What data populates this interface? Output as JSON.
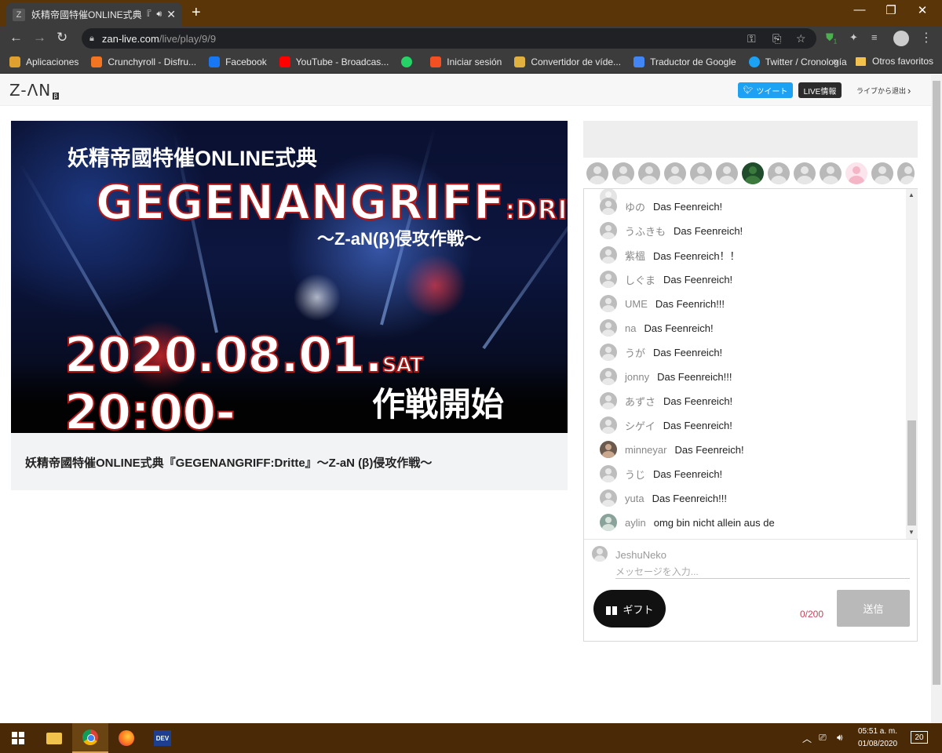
{
  "browser": {
    "tab_title": "妖精帝國特催ONLINE式典『G",
    "url_host": "zan-live.com",
    "url_path": "/live/play/9/9",
    "bookmarks": [
      {
        "label": "Aplicaciones",
        "color": "#e0a030"
      },
      {
        "label": "Crunchyroll - Disfru...",
        "color": "#f47521"
      },
      {
        "label": "Facebook",
        "color": "#1877f2"
      },
      {
        "label": "YouTube - Broadcas...",
        "color": "#ff0000"
      },
      {
        "label": "",
        "color": "#25d366"
      },
      {
        "label": "Iniciar sesión",
        "color": "#f25022"
      },
      {
        "label": "Convertidor de víde...",
        "color": "#e0b040"
      },
      {
        "label": "Traductor de Google",
        "color": "#4285f4"
      },
      {
        "label": "Twitter / Cronología",
        "color": "#1da1f2"
      }
    ],
    "bookmarks_more": "»",
    "other_favorites": "Otros favoritos",
    "extension_badge": "1"
  },
  "header": {
    "logo": "Z-ΛN",
    "logo_badge": "β",
    "tweet_label": "ツイート",
    "live_info_label": "LIVE情報",
    "exit_label": "ライブから退出"
  },
  "video": {
    "subtitle": "妖精帝國特催ONLINE式典",
    "main_title": "GEGENANGRIFF",
    "main_title_suffix": ":DRITTE",
    "tagline": "〜Z-aN(β)侵攻作戦〜",
    "date": "2020.08.01.",
    "weekday": "SAT",
    "time": "20:00-",
    "start": "作戦開始"
  },
  "event_title": "妖精帝國特催ONLINE式典『GEGENANGRIFF:Dritte』〜Z-aN (β)侵攻作戦〜",
  "chat": {
    "messages": [
      {
        "name": "ゆの",
        "text": "Das Feenreich!",
        "avatar": "default"
      },
      {
        "name": "うふきも",
        "text": "Das Feenreich!",
        "avatar": "default"
      },
      {
        "name": "紫榲",
        "text": "Das Feenreich！！",
        "avatar": "default"
      },
      {
        "name": "しぐま",
        "text": "Das Feenreich!",
        "avatar": "default"
      },
      {
        "name": "UME",
        "text": "Das Feenrich!!!",
        "avatar": "default"
      },
      {
        "name": "na",
        "text": "Das Feenreich!",
        "avatar": "default"
      },
      {
        "name": "うが",
        "text": "Das Feenreich!",
        "avatar": "default"
      },
      {
        "name": "jonny",
        "text": "Das Feenreich!!!",
        "avatar": "default"
      },
      {
        "name": "あずさ",
        "text": "Das Feenreich!",
        "avatar": "default"
      },
      {
        "name": "シゲイ",
        "text": "Das Feenreich!",
        "avatar": "default"
      },
      {
        "name": "minneyar",
        "text": "Das Feenreich!",
        "avatar": "photo"
      },
      {
        "name": "うじ",
        "text": "Das Feenreich!",
        "avatar": "default"
      },
      {
        "name": "yuta",
        "text": "Das Feenreich!!!",
        "avatar": "default"
      },
      {
        "name": "aylin",
        "text": "omg bin nicht allein aus de",
        "avatar": "photo2"
      }
    ],
    "current_user": "JeshuNeko",
    "input_placeholder": "メッセージを入力...",
    "gift_label": "ギフト",
    "counter": "0/200",
    "send_label": "送信"
  },
  "taskbar": {
    "time": "05:51 a. m.",
    "date": "01/08/2020",
    "notifications": "20"
  }
}
